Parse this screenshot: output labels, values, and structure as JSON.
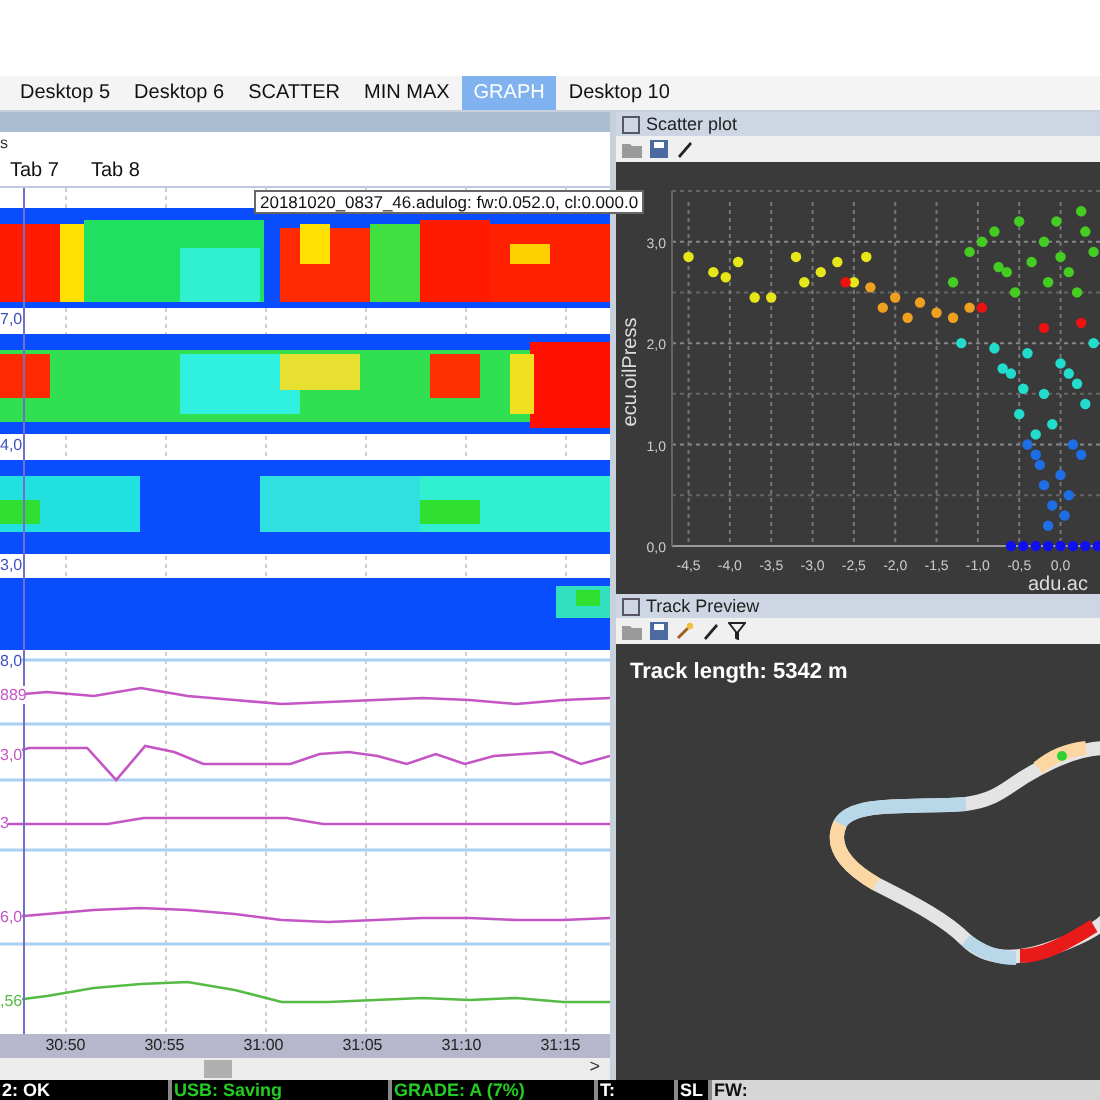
{
  "tabs": [
    {
      "label": "Desktop 5",
      "selected": false
    },
    {
      "label": "Desktop 6",
      "selected": false
    },
    {
      "label": "SCATTER",
      "selected": false
    },
    {
      "label": "MIN MAX",
      "selected": false
    },
    {
      "label": "GRAPH",
      "selected": true
    },
    {
      "label": "Desktop 10",
      "selected": false
    }
  ],
  "left_panel": {
    "title_fragment": "s",
    "sub_tabs": [
      "Tab 7",
      "Tab 8"
    ],
    "tooltip": "20181020_0837_46.adulog: fw:0.052.0, cl:0.000.0",
    "heatmaps": [
      {
        "label": "7,0"
      },
      {
        "label": "4,0"
      },
      {
        "label": "3,0"
      },
      {
        "label": "8,0"
      }
    ],
    "traces": [
      {
        "label": "889",
        "color": "#c455c4"
      },
      {
        "label": "3,0",
        "color": "#c455c4"
      },
      {
        "label": "3",
        "color": "#c455c4"
      },
      {
        "label": "6,0",
        "color": "#c455c4"
      },
      {
        "label": ",56",
        "color": "#55bb44"
      }
    ],
    "time_axis": [
      "30:50",
      "30:55",
      "31:00",
      "31:05",
      "31:10",
      "31:15"
    ],
    "scroll_arrow": ">"
  },
  "scatter": {
    "title": "Scatter plot",
    "chart_data": {
      "type": "scatter",
      "xlabel": "adu.ac",
      "ylabel": "ecu.oilPress",
      "xlim": [
        -4.7,
        0.55
      ],
      "ylim": [
        0,
        3.5
      ],
      "grid": true,
      "xticks": [
        {
          "value": -4.5,
          "label": "-4,5"
        },
        {
          "value": -4,
          "label": "-4,0"
        },
        {
          "value": -3.5,
          "label": "-3,5"
        },
        {
          "value": -3,
          "label": "-3,0"
        },
        {
          "value": -2.5,
          "label": "-2,5"
        },
        {
          "value": -2,
          "label": "-2,0"
        },
        {
          "value": -1.5,
          "label": "-1,5"
        },
        {
          "value": -1,
          "label": "-1,0"
        },
        {
          "value": -0.5,
          "label": "-0,5"
        },
        {
          "value": 0,
          "label": "0,0"
        }
      ],
      "yticks": [
        {
          "value": 0,
          "label": "0,0"
        },
        {
          "value": 1,
          "label": "1,0"
        },
        {
          "value": 2,
          "label": "2,0"
        },
        {
          "value": 3,
          "label": "3,0"
        }
      ],
      "series": [
        {
          "color": "#e6e619",
          "x": [
            -4.5,
            -4.2,
            -4.05,
            -3.9,
            -3.7,
            -3.5,
            -3.2,
            -3.1,
            -2.9,
            -2.7,
            -2.5,
            -2.35
          ],
          "values": [
            2.85,
            2.7,
            2.65,
            2.8,
            2.45,
            2.45,
            2.85,
            2.6,
            2.7,
            2.8,
            2.6,
            2.85
          ]
        },
        {
          "color": "#f0a020",
          "x": [
            -2.3,
            -2.15,
            -2.0,
            -1.85,
            -1.7,
            -1.5,
            -1.3,
            -1.1
          ],
          "values": [
            2.55,
            2.35,
            2.45,
            2.25,
            2.4,
            2.3,
            2.25,
            2.35
          ]
        },
        {
          "color": "#44cc22",
          "x": [
            -1.3,
            -1.1,
            -0.95,
            -0.8,
            -0.65,
            -0.5,
            -0.35,
            -0.2,
            -0.05,
            0.1,
            0.25,
            0.4,
            -0.55,
            -0.15,
            0.3,
            -0.75,
            0.0,
            0.2
          ],
          "values": [
            2.6,
            2.9,
            3.0,
            3.1,
            2.7,
            3.2,
            2.8,
            3.0,
            3.2,
            2.7,
            3.3,
            2.9,
            2.5,
            2.6,
            3.1,
            2.75,
            2.85,
            2.5
          ]
        },
        {
          "color": "#22ddcc",
          "x": [
            -1.2,
            -0.8,
            -0.6,
            -0.4,
            -0.2,
            0.0,
            0.2,
            0.4,
            -0.5,
            -0.1,
            0.3,
            -0.3,
            0.1,
            -0.7,
            -0.45
          ],
          "values": [
            2.0,
            1.95,
            1.7,
            1.9,
            1.5,
            1.8,
            1.6,
            2.0,
            1.3,
            1.2,
            1.4,
            1.1,
            1.7,
            1.75,
            1.55
          ]
        },
        {
          "color": "#1e6ee6",
          "x": [
            -0.3,
            -0.2,
            -0.1,
            0.0,
            0.1,
            -0.15,
            0.05,
            -0.4,
            0.25,
            -0.25,
            0.15
          ],
          "values": [
            0.9,
            0.6,
            0.4,
            0.7,
            0.5,
            0.2,
            0.3,
            1.0,
            0.9,
            0.8,
            1.0
          ]
        },
        {
          "color": "#1010ee",
          "x": [
            -0.6,
            -0.45,
            -0.3,
            -0.15,
            0.0,
            0.15,
            0.3,
            0.45
          ],
          "values": [
            0.0,
            0.0,
            0.0,
            0.0,
            0.0,
            0.0,
            0.0,
            0.0
          ]
        },
        {
          "color": "#ee1111",
          "x": [
            -2.6,
            -0.95,
            -0.2,
            0.25
          ],
          "values": [
            2.6,
            2.35,
            2.15,
            2.2
          ]
        }
      ]
    }
  },
  "track": {
    "title": "Track Preview",
    "length": "Track length: 5342 m"
  },
  "status_bar": [
    {
      "text": "2: OK",
      "color": "#ffffff",
      "kind": "dark"
    },
    {
      "text": "USB: Saving",
      "color": "#22cc22",
      "kind": "dark"
    },
    {
      "text": "GRADE: A (7%)",
      "color": "#22cc22",
      "kind": "dark"
    },
    {
      "text": "T:",
      "color": "#ffffff",
      "kind": "dark"
    },
    {
      "text": "SL",
      "color": "#ffffff",
      "kind": "dark"
    },
    {
      "text": "FW:",
      "color": "#111111",
      "kind": "light"
    }
  ]
}
